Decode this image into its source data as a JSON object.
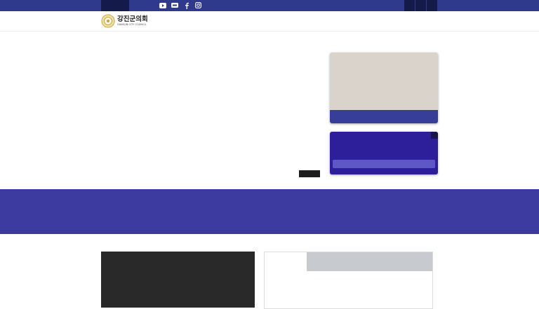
{
  "header": {
    "title": "강진군의회",
    "subtitle": "GANGJIN CITY COUNCIL"
  },
  "social": [
    "youtube-icon",
    "blog-icon",
    "facebook-icon",
    "instagram-icon"
  ],
  "colors": {
    "brand": "#2f3a8c",
    "band": "#3d3ba0",
    "card_accent": "#2c1f99"
  }
}
